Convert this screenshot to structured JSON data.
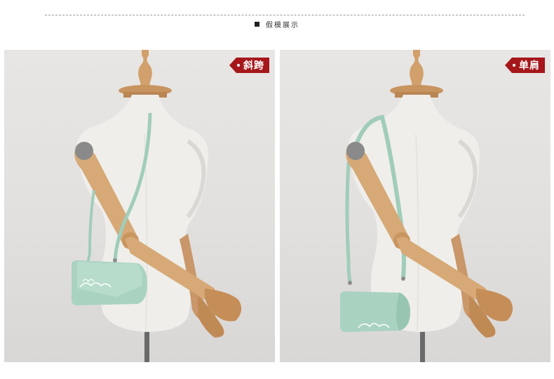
{
  "header": {
    "title": "假模展示"
  },
  "panels": [
    {
      "tag": "斜跨"
    },
    {
      "tag": "单肩"
    }
  ],
  "colors": {
    "tag_background": "#a5171a",
    "bag": "#a9d3c0",
    "mannequin": "#efeeea",
    "wood": "#d6a977"
  },
  "icons": {
    "header_bullet": "black-square-icon",
    "tag_marker": "dot-icon"
  }
}
